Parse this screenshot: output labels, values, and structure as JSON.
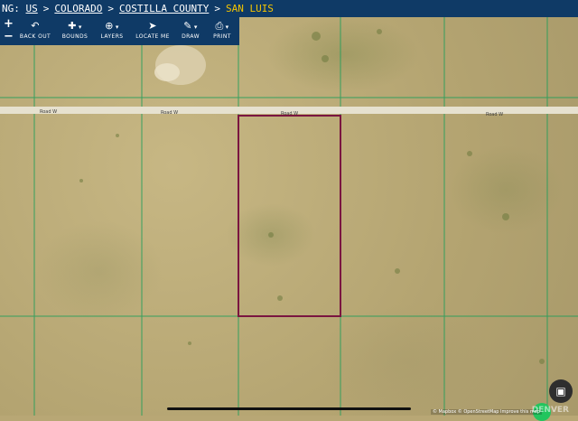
{
  "breadcrumb": {
    "prefix": "NG:",
    "items": [
      "US",
      "COLORADO",
      "COSTILLA COUNTY"
    ],
    "current": "SAN LUIS",
    "separator": ">"
  },
  "toolbar": {
    "zoom_in": "+",
    "zoom_out": "−",
    "back_out": "BACK OUT",
    "bounds": "BOUNDS",
    "layers": "LAYERS",
    "locate_me": "LOCATE ME",
    "draw": "DRAW",
    "print": "PRINT"
  },
  "map": {
    "road_labels": [
      "Road W",
      "Road W",
      "Road W",
      "Road W"
    ],
    "attribution": "© Mapbox © OpenStreetMap Improve this map",
    "watermark": "DENVER"
  },
  "colors": {
    "toolbar_bg": "#0f3a66",
    "current_crumb": "#f4c400",
    "parcel_line": "#1e9e5a",
    "selected_parcel": "#7a1540",
    "road": "#e6e1cf"
  },
  "icons": {
    "back_out": "back-arrow-icon",
    "bounds": "puzzle-icon",
    "layers": "globe-icon",
    "locate_me": "location-arrow-icon",
    "draw": "pencil-icon",
    "print": "printer-icon",
    "qr": "qr-scan-icon"
  }
}
